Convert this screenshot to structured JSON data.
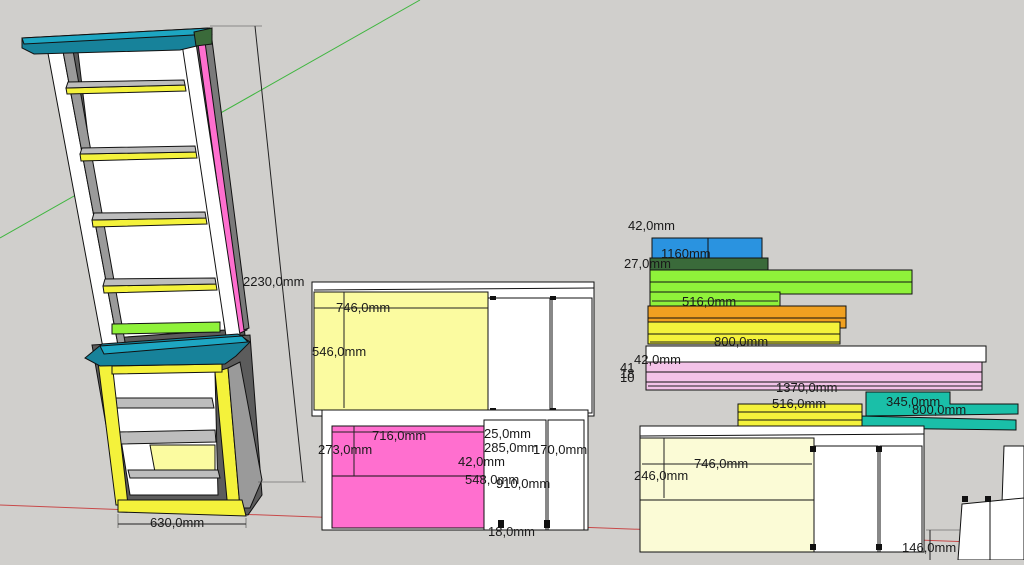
{
  "app": "SketchUp model view",
  "colors": {
    "background": "#d0cfcc",
    "green_axis": "#3fb63f",
    "red_axis": "#c84a4a",
    "teal": "#17829a",
    "yellow": "#f4f23b",
    "magenta": "#ff6fcf",
    "pale_yellow": "#fbfba0",
    "lime": "#8ff23a",
    "orange": "#f0a020",
    "blue": "#2a93e0",
    "dark_green": "#3a6a3a",
    "pink": "#f3c3e8",
    "cream": "#fbfbd6",
    "white": "#ffffff",
    "gray_shelf": "#bdbdbd",
    "dark_gray": "#6a6a6a"
  },
  "dimensions": {
    "tower_height": "2230,0mm",
    "tower_width": "630,0mm",
    "panel_top_width": "746,0mm",
    "panel_top_height": "546,0mm",
    "pink_width": "716,0mm",
    "pink_height": "273,0mm",
    "small_a": "42,0mm",
    "small_b": "548,0mm",
    "small_c": "18,0mm",
    "cluster_1": "25,0mm",
    "cluster_2": "285,0mm",
    "cluster_3": "170,0mm",
    "cluster_4": "910,0mm",
    "cluster_5": "18,0mm",
    "stack_top": "42,0mm",
    "stack_overlap": "27,0mm",
    "stack_overlap_2": "1160mm",
    "lime_len": "516,0mm",
    "orange_len": "800,0mm",
    "stack_left": "42,0mm",
    "left_a": "41",
    "left_b": "18",
    "left_c": "10",
    "long_len": "1370,0mm",
    "bottom_len": "516,0mm",
    "teal_len": "345,0mm",
    "teal_len_2": "800,0mm",
    "right_panel_width": "746,0mm",
    "right_panel_height": "246,0mm",
    "corner_dim": "146,0mm"
  }
}
